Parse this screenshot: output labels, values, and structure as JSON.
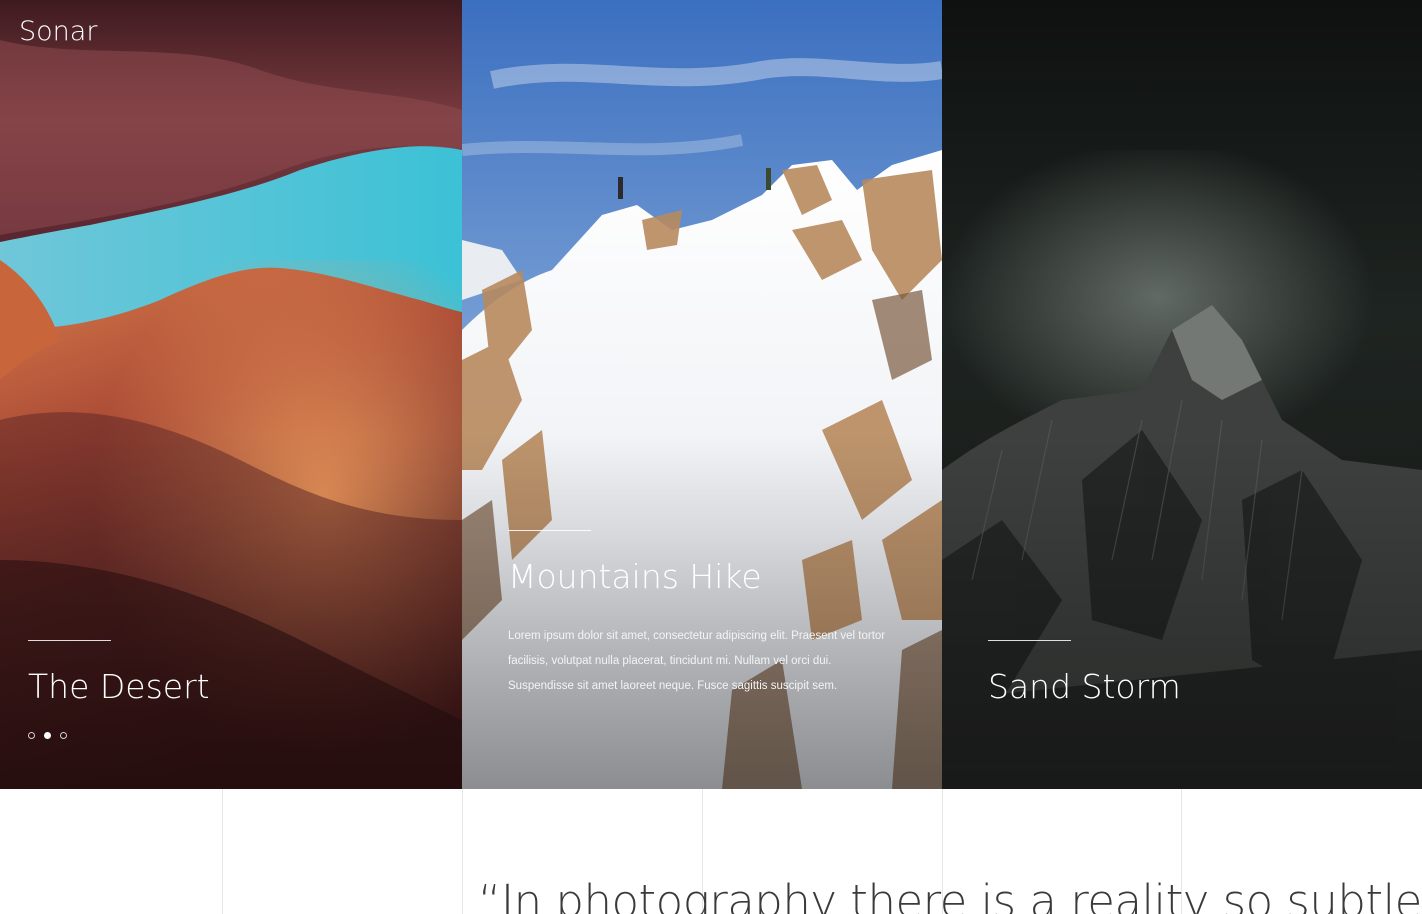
{
  "site": {
    "brand": "Sonar"
  },
  "panels": [
    {
      "id": "desert",
      "title": "The Desert"
    },
    {
      "id": "mountains",
      "title": "Mountains Hike",
      "text": "Lorem ipsum dolor sit amet, consectetur adipiscing elit. Praesent vel tortor facilisis, volutpat nulla placerat, tincidunt mi. Nullam vel orci dui. Suspendisse sit amet laoreet neque. Fusce sagittis suscipit sem."
    },
    {
      "id": "storm",
      "title": "Sand Storm"
    }
  ],
  "slider": {
    "dot_count": 3,
    "active_index": 1
  },
  "quote": {
    "text": "“In photography there is a reality so subtle that"
  },
  "colors": {
    "accent_text": "#ffffff",
    "quote_text": "#3a3a3a",
    "divider": "#e6e6e6"
  }
}
